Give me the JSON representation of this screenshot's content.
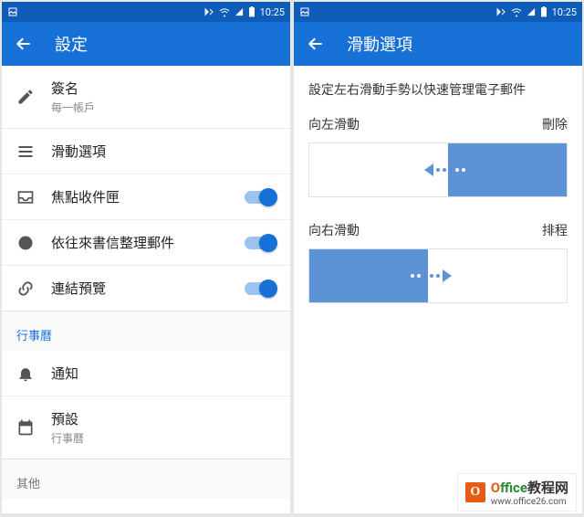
{
  "status": {
    "time": "10:25"
  },
  "left": {
    "title": "設定",
    "signature": {
      "label": "簽名",
      "sub": "每一帳戶"
    },
    "swipe_options": "滑動選項",
    "focused_inbox": "焦點收件匣",
    "sort_by_sender": "依往來書信整理郵件",
    "link_preview": "連結預覽",
    "section_calendar": "行事曆",
    "notifications": "通知",
    "default": {
      "label": "預設",
      "sub": "行事曆"
    },
    "section_other": "其他"
  },
  "right": {
    "title": "滑動選項",
    "desc": "設定左右滑動手勢以快速管理電子郵件",
    "swipe_left": {
      "dir": "向左滑動",
      "action": "刪除"
    },
    "swipe_right": {
      "dir": "向右滑動",
      "action": "排程"
    }
  },
  "watermark": {
    "brand1": "O",
    "brand2": "ffice",
    "brand3": "教程网",
    "url": "www.office26.com"
  }
}
